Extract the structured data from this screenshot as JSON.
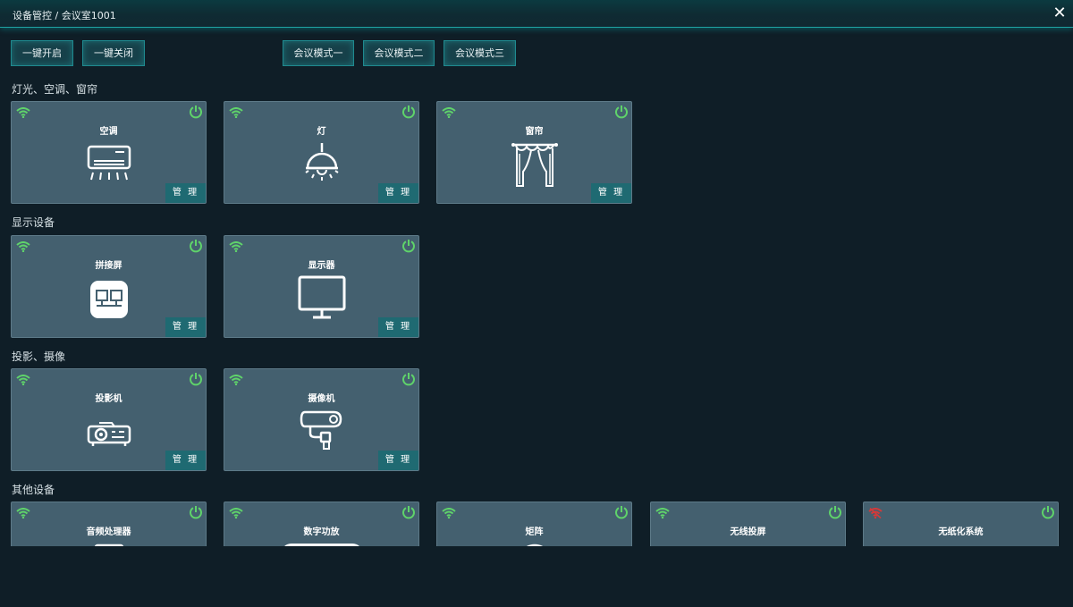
{
  "header": {
    "breadcrumb": "设备管控 / 会议室1001",
    "close": "✕"
  },
  "toolbar": {
    "all_on": "一键开启",
    "all_off": "一键关闭",
    "mode1": "会议模式一",
    "mode2": "会议模式二",
    "mode3": "会议模式三"
  },
  "sections": {
    "lighting": "灯光、空调、窗帘",
    "display": "显示设备",
    "projection": "投影、摄像",
    "other": "其他设备"
  },
  "manage_label": "管 理",
  "devices": {
    "ac": {
      "name": "空调",
      "icon": "air-conditioner-icon",
      "online": true
    },
    "light": {
      "name": "灯",
      "icon": "lamp-icon",
      "online": true
    },
    "curtain": {
      "name": "窗帘",
      "icon": "curtain-icon",
      "online": true
    },
    "videowall": {
      "name": "拼接屏",
      "icon": "video-wall-icon",
      "online": true
    },
    "monitor": {
      "name": "显示器",
      "icon": "monitor-icon",
      "online": true
    },
    "projector": {
      "name": "投影机",
      "icon": "projector-icon",
      "online": true
    },
    "camera": {
      "name": "摄像机",
      "icon": "camera-icon",
      "online": true
    },
    "audio": {
      "name": "音频处理器",
      "icon": "audio-processor-icon",
      "online": true
    },
    "amp": {
      "name": "数字功放",
      "icon": "amplifier-icon",
      "online": true
    },
    "matrix": {
      "name": "矩阵",
      "icon": "matrix-icon",
      "online": true
    },
    "wireless": {
      "name": "无线投屏",
      "icon": "wireless-cast-icon",
      "online": true
    },
    "paperless": {
      "name": "无纸化系统",
      "icon": "paperless-icon",
      "online": false
    }
  },
  "colors": {
    "wifi_online": "#5fd36a",
    "wifi_offline": "#d23a3a",
    "power": "#5fd36a",
    "accent": "#1f8a8f"
  }
}
